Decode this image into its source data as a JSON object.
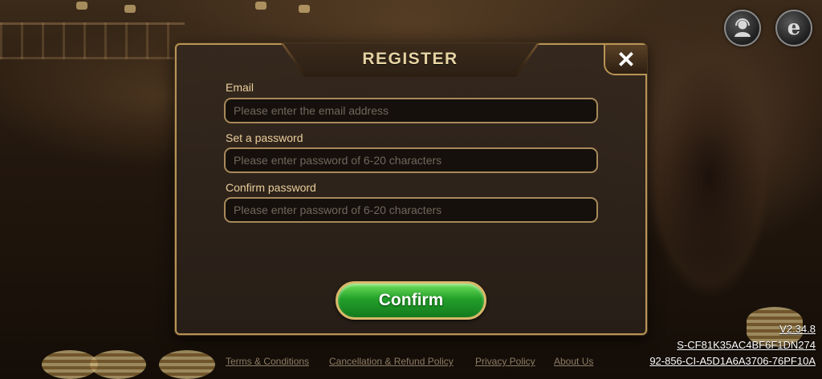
{
  "dialog": {
    "title": "REGISTER",
    "close_symbol": "✕",
    "email": {
      "label": "Email",
      "placeholder": "Please enter the email address"
    },
    "password": {
      "label": "Set a password",
      "placeholder": "Please enter password of 6-20 characters"
    },
    "confirm_password": {
      "label": "Confirm password",
      "placeholder": "Please enter password of 6-20 characters"
    },
    "confirm_label": "Confirm"
  },
  "top_icons": {
    "user_icon": "user-avatar-icon",
    "language_icon": "e",
    "language_icon_name": "browser-e-icon"
  },
  "footer": {
    "links": [
      "Terms & Conditions",
      "Cancellation & Refund Policy",
      "Privacy Policy",
      "About Us"
    ]
  },
  "version_info": {
    "version": "V2.34.8",
    "line2": "S-CF81K35AC4BF6F1DN274",
    "line3": "92-856-CI-A5D1A6A3706-76PF10A"
  },
  "colors": {
    "accent_gold": "#b89455",
    "label_gold": "#e9cf9c",
    "confirm_green": "#23a02a"
  }
}
